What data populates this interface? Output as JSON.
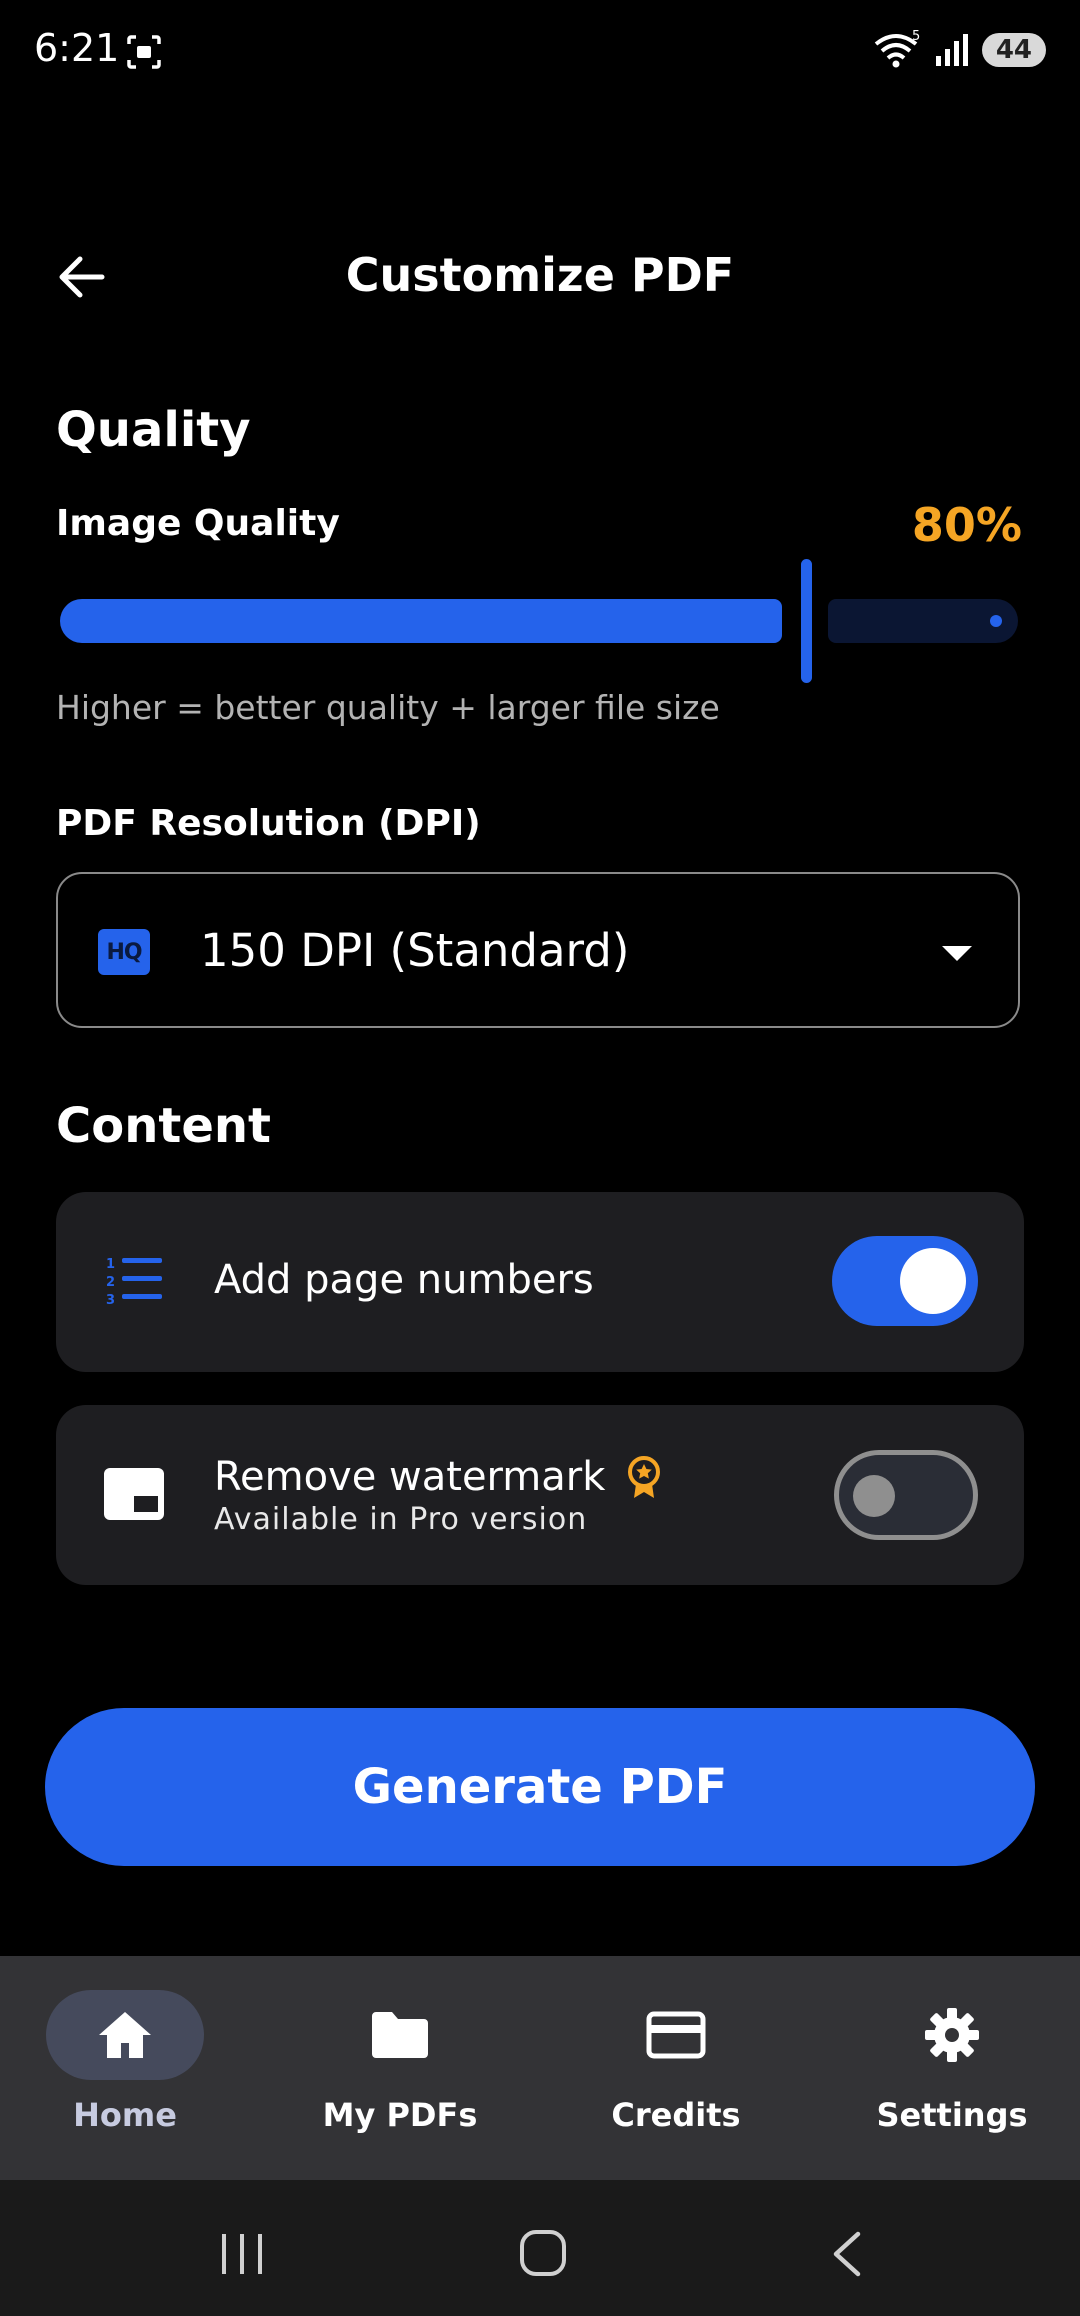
{
  "status_bar": {
    "time": "6:21",
    "battery": "44"
  },
  "header": {
    "title": "Customize PDF"
  },
  "quality": {
    "section_title": "Quality",
    "label": "Image Quality",
    "value_text": "80%",
    "value": 0.8,
    "hint": "Higher = better quality + larger file size"
  },
  "resolution": {
    "label": "PDF Resolution (DPI)",
    "badge": "HQ",
    "selected": "150 DPI (Standard)"
  },
  "content": {
    "section_title": "Content",
    "page_numbers": {
      "label": "Add page numbers",
      "enabled": true
    },
    "watermark": {
      "label": "Remove watermark",
      "sublabel": "Available in Pro version",
      "enabled": false
    }
  },
  "generate_button": "Generate PDF",
  "nav": {
    "items": [
      {
        "label": "Home",
        "icon": "home-icon",
        "active": true
      },
      {
        "label": "My PDFs",
        "icon": "folder-icon",
        "active": false
      },
      {
        "label": "Credits",
        "icon": "credit-card-icon",
        "active": false
      },
      {
        "label": "Settings",
        "icon": "gear-icon",
        "active": false
      }
    ]
  },
  "colors": {
    "accent": "#2563eb",
    "highlight": "#f5a524",
    "background": "#000000",
    "card": "#1e1e21"
  }
}
